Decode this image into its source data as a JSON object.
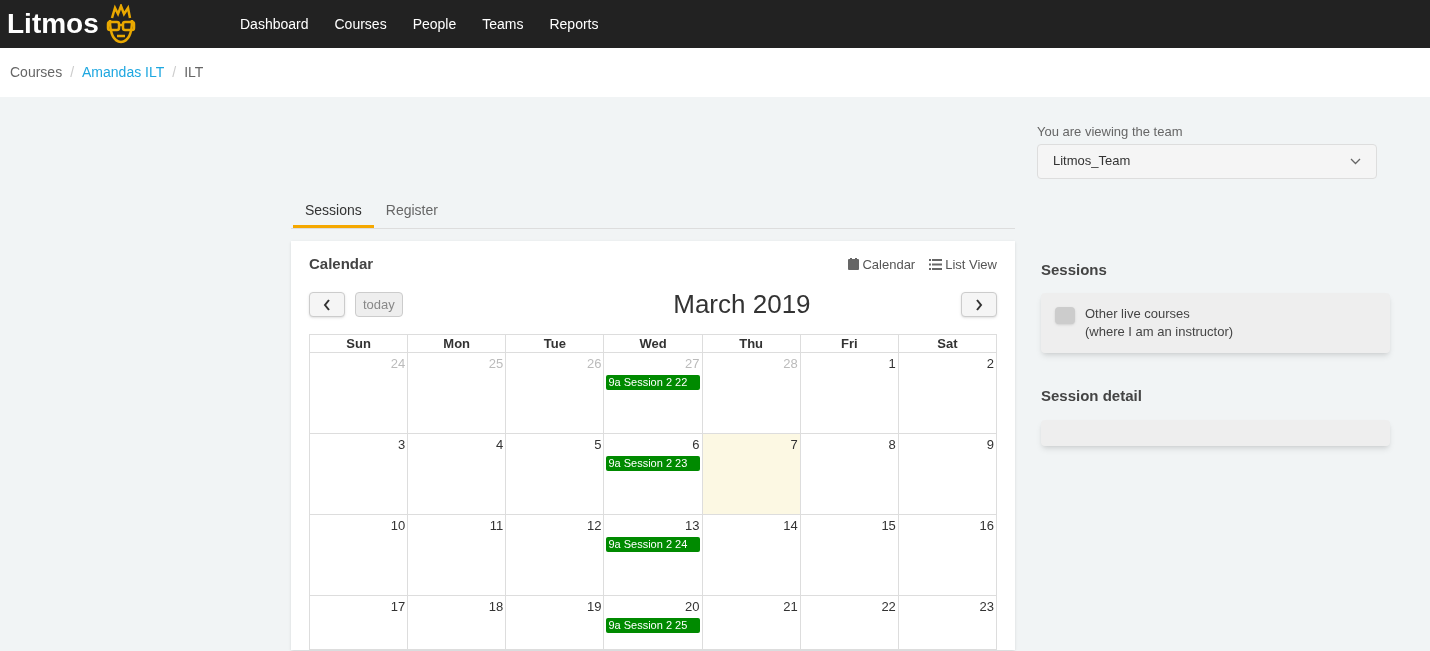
{
  "nav": {
    "logo": "Litmos",
    "items": [
      {
        "label": "Dashboard"
      },
      {
        "label": "Courses"
      },
      {
        "label": "People"
      },
      {
        "label": "Teams"
      },
      {
        "label": "Reports"
      }
    ]
  },
  "breadcrumb": {
    "separator": "/",
    "items": [
      {
        "label": "Courses",
        "link": false
      },
      {
        "label": "Amandas ILT",
        "link": true
      },
      {
        "label": "ILT",
        "link": false
      }
    ]
  },
  "team_select": {
    "label": "You are viewing the team",
    "value": "Litmos_Team"
  },
  "tabs": [
    {
      "label": "Sessions",
      "selected": true
    },
    {
      "label": "Register",
      "selected": false
    }
  ],
  "calendar": {
    "title": "Calendar",
    "views": [
      {
        "label": "Calendar"
      },
      {
        "label": "List View"
      }
    ],
    "today_button": "today",
    "month": "March 2019",
    "weekdays": [
      "Sun",
      "Mon",
      "Tue",
      "Wed",
      "Thu",
      "Fri",
      "Sat"
    ],
    "weeks": [
      {
        "days": [
          {
            "number": "24",
            "other_month": true,
            "today": false
          },
          {
            "number": "25",
            "other_month": true,
            "today": false
          },
          {
            "number": "26",
            "other_month": true,
            "today": false
          },
          {
            "number": "27",
            "other_month": true,
            "today": false,
            "events": [
              {
                "label": "9a Session 2 22",
                "color": "#008a00"
              }
            ]
          },
          {
            "number": "28",
            "other_month": true,
            "today": false
          },
          {
            "number": "1",
            "other_month": false,
            "today": false
          },
          {
            "number": "2",
            "other_month": false,
            "today": false
          }
        ]
      },
      {
        "days": [
          {
            "number": "3",
            "other_month": false,
            "today": false
          },
          {
            "number": "4",
            "other_month": false,
            "today": false
          },
          {
            "number": "5",
            "other_month": false,
            "today": false
          },
          {
            "number": "6",
            "other_month": false,
            "today": false,
            "events": [
              {
                "label": "9a Session 2 23",
                "color": "#008a00"
              }
            ]
          },
          {
            "number": "7",
            "other_month": false,
            "today": true
          },
          {
            "number": "8",
            "other_month": false,
            "today": false
          },
          {
            "number": "9",
            "other_month": false,
            "today": false
          }
        ]
      },
      {
        "days": [
          {
            "number": "10",
            "other_month": false,
            "today": false
          },
          {
            "number": "11",
            "other_month": false,
            "today": false
          },
          {
            "number": "12",
            "other_month": false,
            "today": false
          },
          {
            "number": "13",
            "other_month": false,
            "today": false,
            "events": [
              {
                "label": "9a Session 2 24",
                "color": "#008a00"
              }
            ]
          },
          {
            "number": "14",
            "other_month": false,
            "today": false
          },
          {
            "number": "15",
            "other_month": false,
            "today": false
          },
          {
            "number": "16",
            "other_month": false,
            "today": false
          }
        ]
      },
      {
        "days": [
          {
            "number": "17",
            "other_month": false,
            "today": false
          },
          {
            "number": "18",
            "other_month": false,
            "today": false
          },
          {
            "number": "19",
            "other_month": false,
            "today": false
          },
          {
            "number": "20",
            "other_month": false,
            "today": false,
            "events": [
              {
                "label": "9a Session 2 25",
                "color": "#008a00"
              }
            ]
          },
          {
            "number": "21",
            "other_month": false,
            "today": false
          },
          {
            "number": "22",
            "other_month": false,
            "today": false
          },
          {
            "number": "23",
            "other_month": false,
            "today": false
          }
        ]
      }
    ]
  },
  "sessions": {
    "title": "Sessions",
    "toggle": {
      "label": "Other live courses",
      "sublabel": "(where I am an instructor)",
      "checked": false
    }
  },
  "session_detail": {
    "title": "Session detail"
  }
}
